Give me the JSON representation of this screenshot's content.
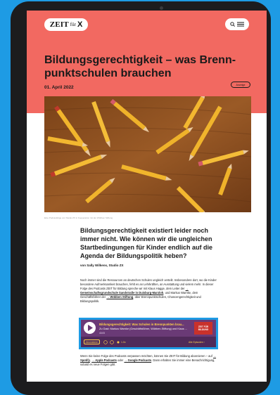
{
  "header": {
    "logo": {
      "zeit": "ZEIT",
      "fuer": "für",
      "x": "X"
    },
    "menu_icons": [
      "search-icon",
      "hamburger-icon"
    ]
  },
  "article": {
    "title": "Bildungsgerechtigkeit – was Brenn-punktschulen brauchen",
    "date": "01. April 2022",
    "share_label": "Anzeige",
    "photo_caption": "Eine Podcastfolge von Studio ZX in Kooperation mit der Wübben Stiftung",
    "lead": "Bildungsgerechtigkeit existiert leider noch immer nicht. Wie können wir die ungleichen Startbedingungen für Kinder endlich auf die Agenda der Bildungspolitik heben?",
    "byline": "von Sally Wilkens, Studio ZX",
    "body": {
      "part1": "Noch immer sind die Ressourcen an deutschen Schulen ungleich verteilt. Insbesondere dort, wo die Kinder besondere Aufmerksamkeit brauchen, fehlt es an Lehrkräften, an Ausstattung und vielem mehr. In dieser Folge des Podcasts ZEIT für Bildung spreche wir mit Klaus Hagge, dem Leiter der",
      "link1": "→ Gemeinschaftsgrundschule Sandstraße in Duisburg-Marxloh",
      "part2": ", und Markus Warnke, dem Geschäftsführer der",
      "link2": "→ Wübben Stiftung",
      "part3": ", über Brennpunktschulen, Chancengerechtigkeit und Bildungspolitik."
    },
    "footer": {
      "part1": "Wenn Sie keine Folge des Podcasts verpassen möchten, können Sie ZEIT für Bildung abonnieren – auf",
      "spotify": "→ Spotify",
      "sep1": ",",
      "apple": "→ Apple Podcasts",
      "sep2": "oder",
      "google": "→ Google Podcasts",
      "part2": ". Dann erhalten Sie immer eine Benachrichtigung, sobald es neue Folgen gibt."
    }
  },
  "player": {
    "episode_title": "Bildungsgerechtigkeit: Was Schulen in Brennpunkten brau...",
    "episode_subtitle": "Zu Gast: Markus Warnke (Geschäftsführer, Wübben-Stiftung) und Klaus ...",
    "time": "43:05",
    "cover_text": "ZEIT FÜR BILDUNG",
    "subscribe_label": "Abonnieren",
    "speed_label": "1.0x",
    "all_episodes_label": "Alle Episoden ›",
    "accent": "#ffd24a",
    "background": "#6a3a76"
  },
  "colors": {
    "hero": "#f26961",
    "device_frame": "#1c1c1e",
    "page_background": "#1e9be4",
    "highlight_border": "#1e9be4"
  }
}
